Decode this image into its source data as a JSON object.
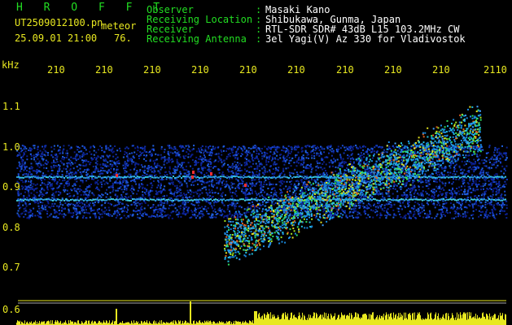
{
  "header": {
    "app_name": "H R O F F T",
    "file_name": "UT2509012100.pn",
    "category": "meteor",
    "datetime": "25.09.01 21:00",
    "count": "76.",
    "fields": [
      {
        "label": "Observer",
        "sep": ":",
        "value": "Masaki Kano"
      },
      {
        "label": "Receiving Location",
        "sep": ":",
        "value": "Shibukawa, Gunma, Japan"
      },
      {
        "label": "Receiver",
        "sep": ":",
        "value": "RTL-SDR SDR# 43dB L15 103.2MHz CW"
      },
      {
        "label": "Receiving Antenna",
        "sep": ":",
        "value": "3el Yagi(V) Az 330 for Vladivostok"
      }
    ]
  },
  "axes": {
    "y_unit": "kHz",
    "y_ticks": [
      "1.1",
      "1.0",
      "0.9",
      "0.8",
      "0.7",
      "0.6"
    ],
    "x_ticks": [
      "210",
      "210",
      "210",
      "210",
      "210",
      "210",
      "210",
      "210",
      "210",
      "2110"
    ]
  },
  "colors": {
    "header_label": "#22dd22",
    "header_value": "#ffffff",
    "axis_text": "#e8e820",
    "power_bars": "#e8e820",
    "background": "#000000"
  }
}
